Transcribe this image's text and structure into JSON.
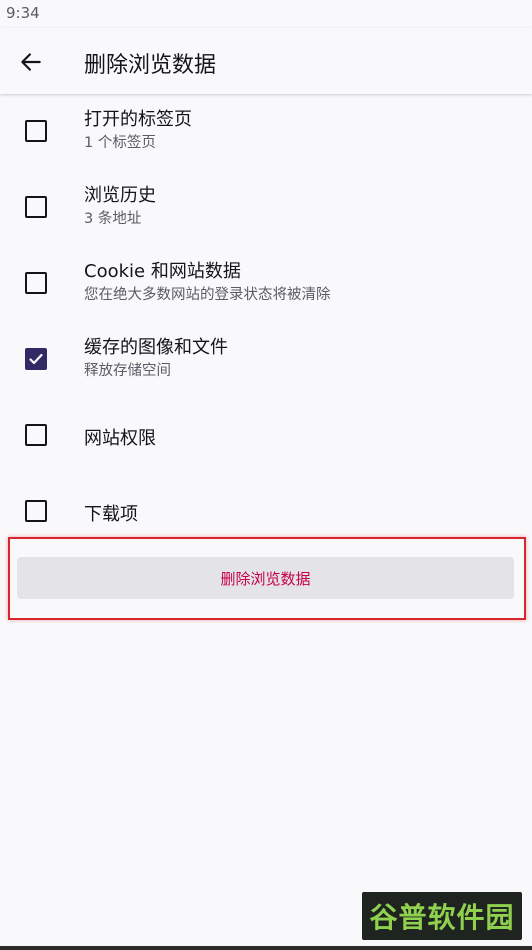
{
  "status_bar": {
    "time": "9:34"
  },
  "app_bar": {
    "title": "删除浏览数据"
  },
  "options": [
    {
      "label": "打开的标签页",
      "sub": "1 个标签页",
      "checked": false
    },
    {
      "label": "浏览历史",
      "sub": "3 条地址",
      "checked": false
    },
    {
      "label": "Cookie 和网站数据",
      "sub": "您在绝大多数网站的登录状态将被清除",
      "checked": false
    },
    {
      "label": "缓存的图像和文件",
      "sub": "释放存储空间",
      "checked": true
    },
    {
      "label": "网站权限",
      "checked": false
    },
    {
      "label": "下载项",
      "checked": false
    }
  ],
  "delete_button": {
    "label": "删除浏览数据"
  },
  "watermark": {
    "text": "谷普软件园"
  },
  "colors": {
    "accent": "#312a65",
    "danger_text": "#c50042",
    "highlight": "#d7262e"
  }
}
